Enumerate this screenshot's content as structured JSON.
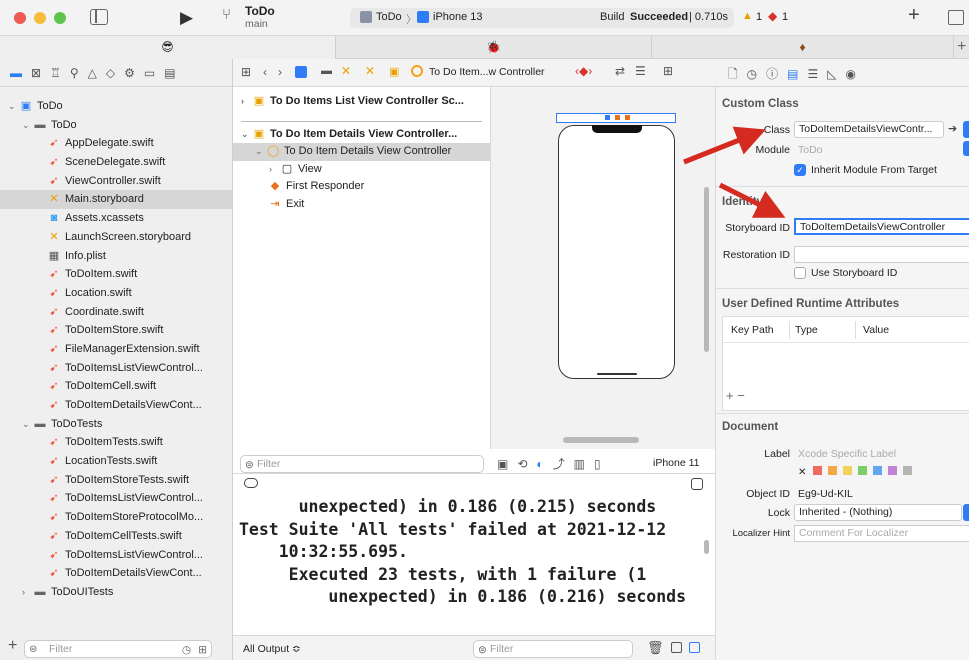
{
  "toolbar": {
    "project_title": "ToDo",
    "branch": "main",
    "scheme": "ToDo",
    "device": "iPhone 13",
    "build_status_prefix": "Build ",
    "build_status_bold": "Succeeded",
    "build_time": "| 0.710s",
    "warnings": "1",
    "errors": "1",
    "add_label": "+"
  },
  "navigator": {
    "items": [
      {
        "label": "ToDo",
        "icon": "project-icon",
        "indent": 0,
        "chev": "v"
      },
      {
        "label": "ToDo",
        "icon": "folder-icon",
        "indent": 1,
        "chev": "v"
      },
      {
        "label": "AppDelegate.swift",
        "icon": "swift-icon",
        "indent": 2
      },
      {
        "label": "SceneDelegate.swift",
        "icon": "swift-icon",
        "indent": 2
      },
      {
        "label": "ViewController.swift",
        "icon": "swift-icon",
        "indent": 2
      },
      {
        "label": "Main.storyboard",
        "icon": "storyboard-icon",
        "indent": 2,
        "selected": true
      },
      {
        "label": "Assets.xcassets",
        "icon": "assets-icon",
        "indent": 2
      },
      {
        "label": "LaunchScreen.storyboard",
        "icon": "storyboard-icon",
        "indent": 2
      },
      {
        "label": "Info.plist",
        "icon": "plist-icon",
        "indent": 2
      },
      {
        "label": "ToDoItem.swift",
        "icon": "swift-icon",
        "indent": 2
      },
      {
        "label": "Location.swift",
        "icon": "swift-icon",
        "indent": 2
      },
      {
        "label": "Coordinate.swift",
        "icon": "swift-icon",
        "indent": 2
      },
      {
        "label": "ToDoItemStore.swift",
        "icon": "swift-icon",
        "indent": 2
      },
      {
        "label": "FileManagerExtension.swift",
        "icon": "swift-icon",
        "indent": 2
      },
      {
        "label": "ToDoItemsListViewControl...",
        "icon": "swift-icon",
        "indent": 2
      },
      {
        "label": "ToDoItemCell.swift",
        "icon": "swift-icon",
        "indent": 2
      },
      {
        "label": "ToDoItemDetailsViewCont...",
        "icon": "swift-icon",
        "indent": 2
      },
      {
        "label": "ToDoTests",
        "icon": "folder-icon",
        "indent": 1,
        "chev": "v"
      },
      {
        "label": "ToDoItemTests.swift",
        "icon": "swift-icon",
        "indent": 2
      },
      {
        "label": "LocationTests.swift",
        "icon": "swift-icon",
        "indent": 2
      },
      {
        "label": "ToDoItemStoreTests.swift",
        "icon": "swift-icon",
        "indent": 2
      },
      {
        "label": "ToDoItemsListViewControl...",
        "icon": "swift-icon",
        "indent": 2
      },
      {
        "label": "ToDoItemStoreProtocolMo...",
        "icon": "swift-icon",
        "indent": 2
      },
      {
        "label": "ToDoItemCellTests.swift",
        "icon": "swift-icon",
        "indent": 2
      },
      {
        "label": "ToDoItemsListViewControl...",
        "icon": "swift-icon",
        "indent": 2
      },
      {
        "label": "ToDoItemDetailsViewCont...",
        "icon": "swift-icon",
        "indent": 2
      },
      {
        "label": "ToDoUITests",
        "icon": "folder-icon",
        "indent": 1,
        "chev": ">"
      }
    ],
    "filter_placeholder": "Filter"
  },
  "jumpbar": {
    "crumb": "To Do Item...w Controller"
  },
  "outline": {
    "scene1": "To Do Items List View Controller Sc...",
    "scene2": "To Do Item Details View Controller...",
    "vc": "To Do Item Details View Controller",
    "view": "View",
    "first_responder": "First Responder",
    "exit": "Exit",
    "filter_placeholder": "Filter"
  },
  "canvas": {
    "device_label": "iPhone 11"
  },
  "console": {
    "lines": [
      "      unexpected) in 0.186 (0.215) seconds",
      "Test Suite 'All tests' failed at 2021-12-12",
      "    10:32:55.695.",
      "     Executed 23 tests, with 1 failure (1",
      "         unexpected) in 0.186 (0.216) seconds"
    ],
    "output_selector": "All Output ≎",
    "filter_placeholder": "Filter"
  },
  "inspector": {
    "custom_class_title": "Custom Class",
    "class_label": "Class",
    "class_value": "ToDoItemDetailsViewContr...",
    "module_label": "Module",
    "module_value": "ToDo",
    "inherit_label": "Inherit Module From Target",
    "identity_title": "Identity",
    "storyboard_id_label": "Storyboard ID",
    "storyboard_id_value": "ToDoItemDetailsViewController",
    "restoration_id_label": "Restoration ID",
    "use_storyboard_id_label": "Use Storyboard ID",
    "runtime_attrs_title": "User Defined Runtime Attributes",
    "col_keypath": "Key Path",
    "col_type": "Type",
    "col_value": "Value",
    "document_title": "Document",
    "doc_label_label": "Label",
    "doc_label_placeholder": "Xcode Specific Label",
    "object_id_label": "Object ID",
    "object_id_value": "Eg9-Ud-KIL",
    "lock_label": "Lock",
    "lock_value": "Inherited - (Nothing)",
    "localizer_label": "Localizer Hint",
    "localizer_placeholder": "Comment For Localizer"
  },
  "colors": {
    "accent": "#2f7cf6",
    "swift": "#f05138",
    "arrow": "#d42a20"
  }
}
